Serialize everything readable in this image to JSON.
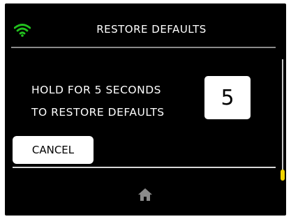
{
  "header": {
    "title": "RESTORE DEFAULTS",
    "status_icon": "wifi-icon"
  },
  "main": {
    "message_line1": "HOLD FOR 5 SECONDS",
    "message_line2": "TO RESTORE DEFAULTS",
    "countdown_value": "5"
  },
  "actions": {
    "cancel_label": "CANCEL"
  },
  "footer": {
    "home_icon": "home-icon"
  },
  "colors": {
    "background": "#000000",
    "wifi": "#22c11e",
    "scroll_thumb": "#f3d400",
    "text": "#ffffff"
  }
}
